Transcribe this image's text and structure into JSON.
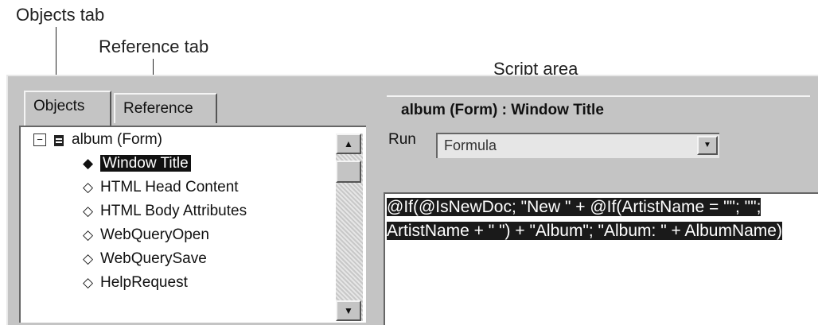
{
  "callouts": {
    "objects_tab": "Objects tab",
    "reference_tab": "Reference tab",
    "script_area": "Script area"
  },
  "tabs": {
    "objects": "Objects",
    "reference": "Reference"
  },
  "tree": {
    "root": "album (Form)",
    "items": [
      {
        "label": "Window Title",
        "icon": "diamond-filled",
        "selected": true
      },
      {
        "label": "HTML Head Content",
        "icon": "diamond-outline"
      },
      {
        "label": "HTML Body Attributes",
        "icon": "diamond-outline"
      },
      {
        "label": "WebQueryOpen",
        "icon": "diamond-outline"
      },
      {
        "label": "WebQuerySave",
        "icon": "diamond-outline"
      },
      {
        "label": "HelpRequest",
        "icon": "diamond-outline"
      }
    ]
  },
  "editor": {
    "title": "album (Form) : Window Title",
    "run_label": "Run",
    "run_value": "Formula",
    "script_text": "@If(@IsNewDoc; \"New \" + @If(ArtistName = \"\"; \"\"; ArtistName + \" \") + \"Album\"; \"Album: \" + AlbumName)"
  }
}
